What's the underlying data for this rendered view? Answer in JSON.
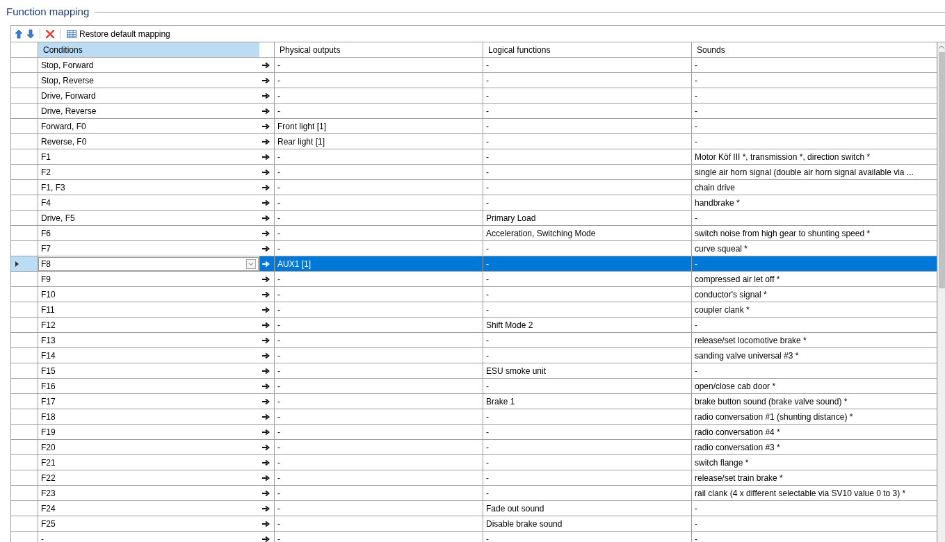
{
  "group_title": "Function mapping",
  "toolbar": {
    "restore_label": "Restore default mapping"
  },
  "columns": [
    {
      "label": "Conditions",
      "selected": true
    },
    {
      "label": "Physical outputs",
      "selected": false
    },
    {
      "label": "Logical functions",
      "selected": false
    },
    {
      "label": "Sounds",
      "selected": false
    }
  ],
  "rows": [
    {
      "conditions": "Stop, Forward",
      "physical": "-",
      "logical": "-",
      "sounds": "-",
      "selected": false
    },
    {
      "conditions": "Stop, Reverse",
      "physical": "-",
      "logical": "-",
      "sounds": "-",
      "selected": false
    },
    {
      "conditions": "Drive, Forward",
      "physical": "-",
      "logical": "-",
      "sounds": "-",
      "selected": false
    },
    {
      "conditions": "Drive, Reverse",
      "physical": "-",
      "logical": "-",
      "sounds": "-",
      "selected": false
    },
    {
      "conditions": "Forward, F0",
      "physical": "Front light [1]",
      "logical": "-",
      "sounds": "-",
      "selected": false
    },
    {
      "conditions": "Reverse, F0",
      "physical": "Rear light [1]",
      "logical": "-",
      "sounds": "-",
      "selected": false
    },
    {
      "conditions": "F1",
      "physical": "-",
      "logical": "-",
      "sounds": "Motor Köf III *, transmission *, direction switch *",
      "selected": false
    },
    {
      "conditions": "F2",
      "physical": "-",
      "logical": "-",
      "sounds": "single air horn signal (double air horn signal available via ...",
      "selected": false
    },
    {
      "conditions": "F1, F3",
      "physical": "-",
      "logical": "-",
      "sounds": "chain drive",
      "selected": false
    },
    {
      "conditions": "F4",
      "physical": "-",
      "logical": "-",
      "sounds": "handbrake *",
      "selected": false
    },
    {
      "conditions": "Drive, F5",
      "physical": "-",
      "logical": "Primary Load",
      "sounds": "-",
      "selected": false
    },
    {
      "conditions": "F6",
      "physical": "-",
      "logical": "Acceleration, Switching Mode",
      "sounds": "switch noise from high gear to shunting speed *",
      "selected": false
    },
    {
      "conditions": "F7",
      "physical": "-",
      "logical": "-",
      "sounds": "curve squeal *",
      "selected": false
    },
    {
      "conditions": "F8",
      "physical": "AUX1 [1]",
      "logical": "-",
      "sounds": "-",
      "selected": true
    },
    {
      "conditions": "F9",
      "physical": "-",
      "logical": "-",
      "sounds": "compressed air let off *",
      "selected": false
    },
    {
      "conditions": "F10",
      "physical": "-",
      "logical": "-",
      "sounds": "conductor's signal *",
      "selected": false
    },
    {
      "conditions": "F11",
      "physical": "-",
      "logical": "-",
      "sounds": "coupler clank *",
      "selected": false
    },
    {
      "conditions": "F12",
      "physical": "-",
      "logical": "Shift Mode 2",
      "sounds": "-",
      "selected": false
    },
    {
      "conditions": "F13",
      "physical": "-",
      "logical": "-",
      "sounds": "release/set locomotive brake *",
      "selected": false
    },
    {
      "conditions": "F14",
      "physical": "-",
      "logical": "-",
      "sounds": "sanding valve universal #3 *",
      "selected": false
    },
    {
      "conditions": "F15",
      "physical": "-",
      "logical": "ESU smoke unit",
      "sounds": "-",
      "selected": false
    },
    {
      "conditions": "F16",
      "physical": "-",
      "logical": "-",
      "sounds": "open/close cab door *",
      "selected": false
    },
    {
      "conditions": "F17",
      "physical": "-",
      "logical": "Brake 1",
      "sounds": "brake button sound (brake valve sound) *",
      "selected": false
    },
    {
      "conditions": "F18",
      "physical": "-",
      "logical": "-",
      "sounds": "radio conversation #1 (shunting distance) *",
      "selected": false
    },
    {
      "conditions": "F19",
      "physical": "-",
      "logical": "-",
      "sounds": "radio conversation #4 *",
      "selected": false
    },
    {
      "conditions": "F20",
      "physical": "-",
      "logical": "-",
      "sounds": "radio conversation #3 *",
      "selected": false
    },
    {
      "conditions": "F21",
      "physical": "-",
      "logical": "-",
      "sounds": "switch flange *",
      "selected": false
    },
    {
      "conditions": "F22",
      "physical": "-",
      "logical": "-",
      "sounds": "release/set train brake *",
      "selected": false
    },
    {
      "conditions": "F23",
      "physical": "-",
      "logical": "-",
      "sounds": "rail clank (4 x different selectable via SV10 value 0 to 3) *",
      "selected": false
    },
    {
      "conditions": "F24",
      "physical": "-",
      "logical": "Fade out sound",
      "sounds": "-",
      "selected": false
    },
    {
      "conditions": "F25",
      "physical": "-",
      "logical": "Disable brake sound",
      "sounds": "-",
      "selected": false
    },
    {
      "conditions": "-",
      "physical": "-",
      "logical": "-",
      "sounds": "-",
      "selected": false
    }
  ]
}
